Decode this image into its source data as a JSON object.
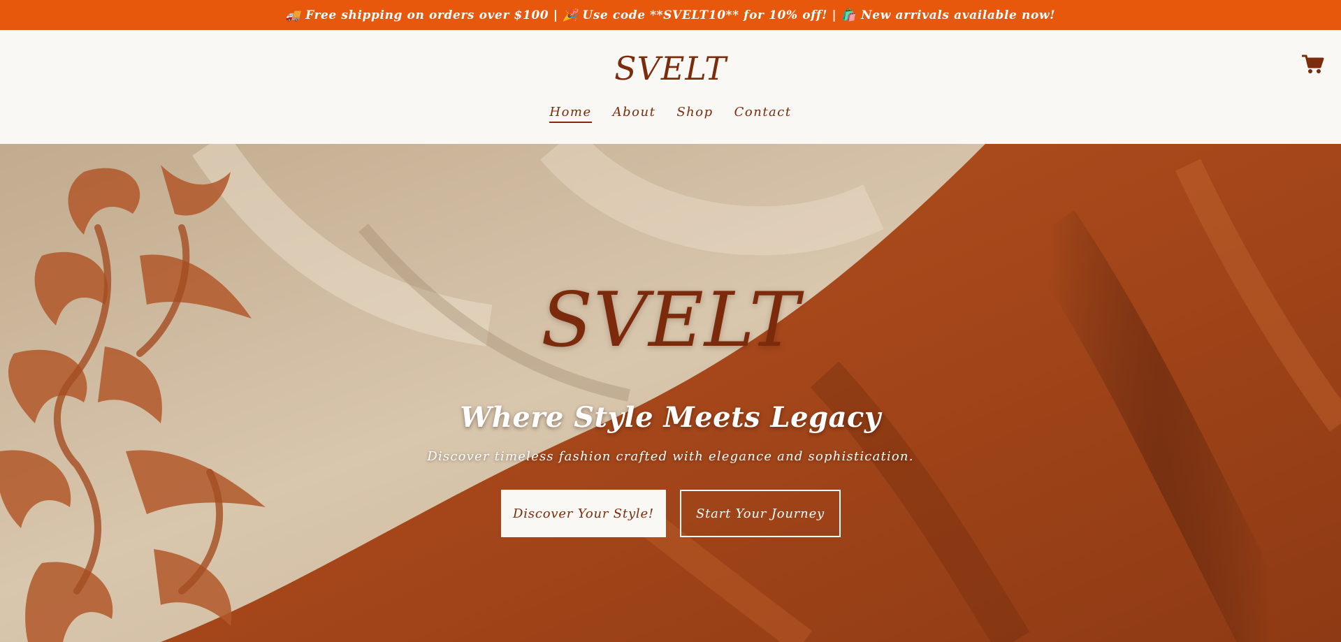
{
  "announcement": {
    "text": "🚚 Free shipping on orders over $100 | 🎉 Use code **SVELT10** for 10% off! | 🛍️ New arrivals available now!"
  },
  "header": {
    "logo": "SVELT",
    "cart_icon": "shopping-cart-icon",
    "nav": [
      {
        "label": "Home",
        "active": true
      },
      {
        "label": "About",
        "active": false
      },
      {
        "label": "Shop",
        "active": false
      },
      {
        "label": "Contact",
        "active": false
      }
    ]
  },
  "hero": {
    "logo": "SVELT",
    "title": "Where Style Meets Legacy",
    "subtitle": "Discover timeless fashion crafted with elegance and sophistication.",
    "primary_button": "Discover Your Style!",
    "secondary_button": "Start Your Journey"
  },
  "colors": {
    "announcement_bg": "#e8580c",
    "brand_brown": "#7a2c0c",
    "cream": "#faf8f4",
    "fabric_rust": "#a9481a",
    "fabric_beige": "#c9b497"
  }
}
